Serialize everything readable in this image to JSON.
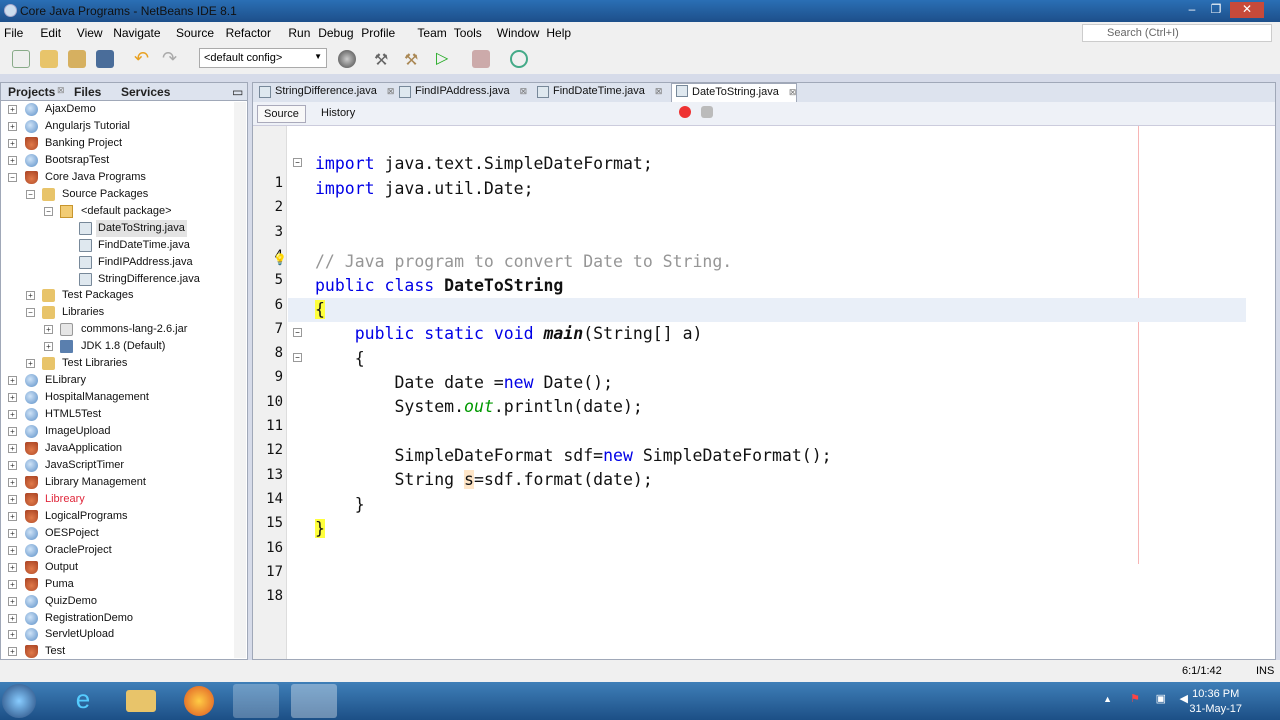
{
  "window": {
    "title": "Core Java Programs - NetBeans IDE 8.1"
  },
  "menu": [
    "File",
    "Edit",
    "View",
    "Navigate",
    "Source",
    "Refactor",
    "Run",
    "Debug",
    "Profile",
    "Team",
    "Tools",
    "Window",
    "Help"
  ],
  "search": {
    "placeholder": "Search (Ctrl+I)"
  },
  "toolbar": {
    "config": "<default config>"
  },
  "left_panel": {
    "tabs": [
      "Projects",
      "Files",
      "Services"
    ],
    "tree": [
      {
        "label": "AjaxDemo",
        "level": 0,
        "icon": "globe",
        "exp": "+"
      },
      {
        "label": "Angularjs Tutorial",
        "level": 0,
        "icon": "globe",
        "exp": "+"
      },
      {
        "label": "Banking Project",
        "level": 0,
        "icon": "cup",
        "exp": "+"
      },
      {
        "label": "BootsrapTest",
        "level": 0,
        "icon": "globe",
        "exp": "+"
      },
      {
        "label": "Core Java Programs",
        "level": 0,
        "icon": "cup",
        "exp": "-"
      },
      {
        "label": "Source Packages",
        "level": 1,
        "icon": "folder",
        "exp": "-"
      },
      {
        "label": "<default package>",
        "level": 2,
        "icon": "pkg",
        "exp": "-"
      },
      {
        "label": "DateToString.java",
        "level": 3,
        "icon": "file",
        "selected": true
      },
      {
        "label": "FindDateTime.java",
        "level": 3,
        "icon": "file"
      },
      {
        "label": "FindIPAddress.java",
        "level": 3,
        "icon": "file"
      },
      {
        "label": "StringDifference.java",
        "level": 3,
        "icon": "file"
      },
      {
        "label": "Test Packages",
        "level": 1,
        "icon": "folder",
        "exp": "+"
      },
      {
        "label": "Libraries",
        "level": 1,
        "icon": "folder",
        "exp": "-"
      },
      {
        "label": "commons-lang-2.6.jar",
        "level": 2,
        "icon": "jar",
        "exp": "+"
      },
      {
        "label": "JDK 1.8 (Default)",
        "level": 2,
        "icon": "jdk",
        "exp": "+"
      },
      {
        "label": "Test Libraries",
        "level": 1,
        "icon": "folder",
        "exp": "+"
      },
      {
        "label": "ELibrary",
        "level": 0,
        "icon": "globe",
        "exp": "+"
      },
      {
        "label": "HospitalManagement",
        "level": 0,
        "icon": "globe",
        "exp": "+"
      },
      {
        "label": "HTML5Test",
        "level": 0,
        "icon": "globe",
        "exp": "+"
      },
      {
        "label": "ImageUpload",
        "level": 0,
        "icon": "globe",
        "exp": "+"
      },
      {
        "label": "JavaApplication",
        "level": 0,
        "icon": "cup",
        "exp": "+"
      },
      {
        "label": "JavaScriptTimer",
        "level": 0,
        "icon": "globe",
        "exp": "+"
      },
      {
        "label": "Library Management",
        "level": 0,
        "icon": "cup",
        "exp": "+"
      },
      {
        "label": "Libreary",
        "level": 0,
        "icon": "cup",
        "exp": "+",
        "error": true
      },
      {
        "label": "LogicalPrograms",
        "level": 0,
        "icon": "cup",
        "exp": "+"
      },
      {
        "label": "OESPoject",
        "level": 0,
        "icon": "globe",
        "exp": "+"
      },
      {
        "label": "OracleProject",
        "level": 0,
        "icon": "globe",
        "exp": "+"
      },
      {
        "label": "Output",
        "level": 0,
        "icon": "cup",
        "exp": "+"
      },
      {
        "label": "Puma",
        "level": 0,
        "icon": "cup",
        "exp": "+"
      },
      {
        "label": "QuizDemo",
        "level": 0,
        "icon": "globe",
        "exp": "+"
      },
      {
        "label": "RegistrationDemo",
        "level": 0,
        "icon": "globe",
        "exp": "+"
      },
      {
        "label": "ServletUpload",
        "level": 0,
        "icon": "globe",
        "exp": "+"
      },
      {
        "label": "Test",
        "level": 0,
        "icon": "cup",
        "exp": "+"
      }
    ]
  },
  "editor": {
    "tabs": [
      {
        "label": "StringDifference.java"
      },
      {
        "label": "FindIPAddress.java"
      },
      {
        "label": "FindDateTime.java"
      },
      {
        "label": "DateToString.java",
        "active": true
      }
    ],
    "source_label": "Source",
    "history_label": "History",
    "current_line": 8,
    "lines": [
      [],
      [
        {
          "t": "import",
          "c": "kw"
        },
        {
          "t": " java.text.SimpleDateFormat;"
        }
      ],
      [
        {
          "t": "import",
          "c": "kw"
        },
        {
          "t": " java.util.Date;"
        }
      ],
      [],
      [],
      [
        {
          "t": "// Java program to convert Date to String.",
          "c": "cm"
        }
      ],
      [
        {
          "t": "public class",
          "c": "kw"
        },
        {
          "t": " "
        },
        {
          "t": "DateToString",
          "c": "cls"
        }
      ],
      [
        {
          "t": "{",
          "c": "brc"
        }
      ],
      [
        {
          "t": "    "
        },
        {
          "t": "public static void",
          "c": "kw"
        },
        {
          "t": " "
        },
        {
          "t": "main",
          "c": "mth"
        },
        {
          "t": "(String[] a)"
        }
      ],
      [
        {
          "t": "    {"
        }
      ],
      [
        {
          "t": "        Date date ="
        },
        {
          "t": "new",
          "c": "kw"
        },
        {
          "t": " Date();"
        }
      ],
      [
        {
          "t": "        System."
        },
        {
          "t": "out",
          "c": "fld"
        },
        {
          "t": ".println(date);"
        }
      ],
      [],
      [
        {
          "t": "        SimpleDateFormat sdf="
        },
        {
          "t": "new",
          "c": "kw"
        },
        {
          "t": " SimpleDateFormat();"
        }
      ],
      [
        {
          "t": "        String "
        },
        {
          "t": "s",
          "c": "var"
        },
        {
          "t": "=sdf.format(date);"
        }
      ],
      [
        {
          "t": "    }"
        }
      ],
      [
        {
          "t": "}",
          "c": "brc"
        }
      ],
      []
    ]
  },
  "status": {
    "position": "6:1/1:42",
    "mode": "INS"
  },
  "taskbar": {
    "time": "10:36 PM",
    "date": "31-May-17"
  }
}
